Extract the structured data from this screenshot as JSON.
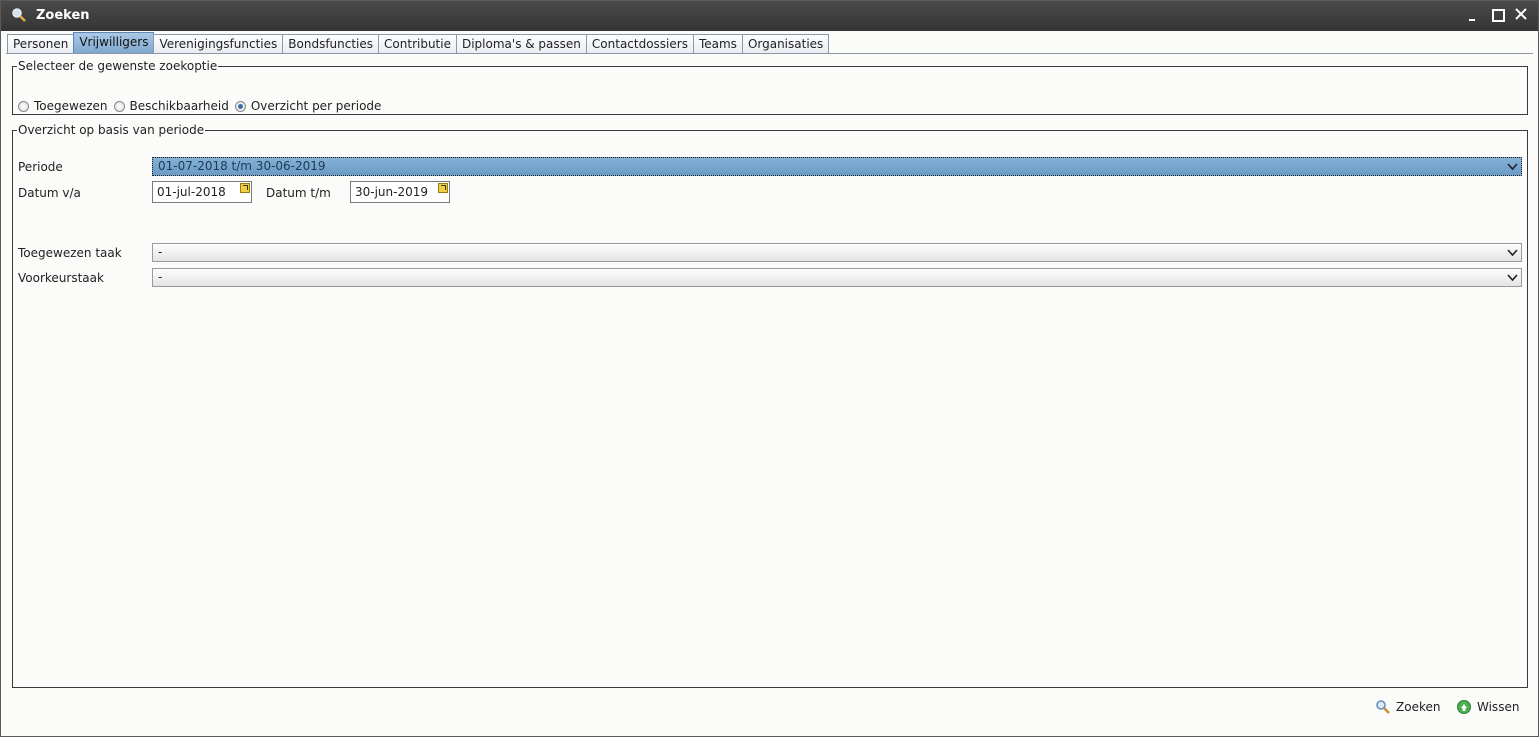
{
  "window": {
    "title": "Zoeken"
  },
  "tabs": [
    {
      "label": "Personen"
    },
    {
      "label": "Vrijwilligers",
      "active": true
    },
    {
      "label": "Verenigingsfuncties"
    },
    {
      "label": "Bondsfuncties"
    },
    {
      "label": "Contributie"
    },
    {
      "label": "Diploma's & passen"
    },
    {
      "label": "Contactdossiers"
    },
    {
      "label": "Teams"
    },
    {
      "label": "Organisaties"
    }
  ],
  "search_option": {
    "legend": "Selecteer de gewenste zoekoptie",
    "options": [
      {
        "label": "Toegewezen",
        "checked": false
      },
      {
        "label": "Beschikbaarheid",
        "checked": false
      },
      {
        "label": "Overzicht per periode",
        "checked": true
      }
    ]
  },
  "period": {
    "legend": "Overzicht op basis van periode",
    "periode_label": "Periode",
    "periode_value": "01-07-2018 t/m 30-06-2019",
    "from_label": "Datum v/a",
    "from_value": "01-jul-2018",
    "to_label": "Datum t/m",
    "to_value": "30-jun-2019",
    "assigned_task_label": "Toegewezen taak",
    "assigned_task_value": "-",
    "preferred_task_label": "Voorkeurstaak",
    "preferred_task_value": "-"
  },
  "footer": {
    "search_label": "Zoeken",
    "clear_label": "Wissen"
  },
  "colors": {
    "titlebar": "#3a3a3a",
    "active_tab": "#8fb3d9",
    "selected_combo": "#6a9bc6",
    "date_picker": "#f2cf3e"
  }
}
